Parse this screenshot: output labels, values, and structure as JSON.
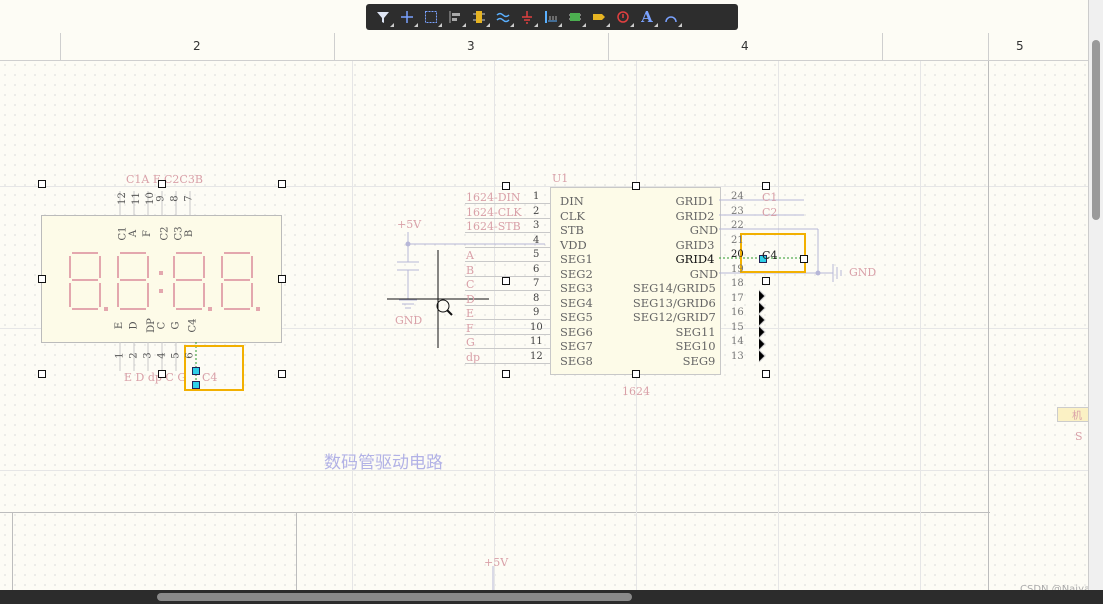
{
  "toolbar": {
    "items": [
      "filter-icon",
      "crosshair-icon",
      "select-rect-icon",
      "align-icon",
      "component-icon",
      "net-icon",
      "ground-icon",
      "bus-icon",
      "harness-icon",
      "port-icon",
      "sheet-symbol-icon",
      "text-icon",
      "arc-icon"
    ]
  },
  "ruler": {
    "cols": [
      "2",
      "3",
      "4",
      "5"
    ]
  },
  "display": {
    "top_labels": "C1A  F  C2C3B",
    "top_pins": [
      "12",
      "11",
      "10",
      "9",
      "8",
      "7"
    ],
    "face_top": [
      "C1",
      "A",
      "F",
      "C2",
      "C3",
      "B"
    ],
    "face_bottom": [
      "E",
      "D",
      "DP",
      "C",
      "G",
      "C4"
    ],
    "bottom_pins": [
      "1",
      "2",
      "3",
      "4",
      "5",
      "6"
    ],
    "bottom_labels": "E  D  dp C  G",
    "digits": "8.8:8.8.",
    "sel_label": "C4"
  },
  "power": {
    "vcc": "+5V",
    "gnd": "GND",
    "vcc2": "+5V"
  },
  "chip": {
    "ref": "U1",
    "name": "1624",
    "left_nets": [
      "1624-DIN",
      "1624-CLK",
      "1624-STB",
      "",
      "A",
      "B",
      "C",
      "D",
      "E",
      "F",
      "G",
      "dp"
    ],
    "left_nums": [
      "1",
      "2",
      "3",
      "4",
      "5",
      "6",
      "7",
      "8",
      "9",
      "10",
      "11",
      "12"
    ],
    "left_pins": [
      "DIN",
      "CLK",
      "STB",
      "VDD",
      "SEG1",
      "SEG2",
      "SEG3",
      "SEG4",
      "SEG5",
      "SEG6",
      "SEG7",
      "SEG8"
    ],
    "right_pins": [
      "GRID1",
      "GRID2",
      "GND",
      "GRID3",
      "GRID4",
      "GND",
      "SEG14/GRID5",
      "SEG13/GRID6",
      "SEG12/GRID7",
      "SEG11",
      "SEG10",
      "SEG9"
    ],
    "right_nums": [
      "24",
      "23",
      "22",
      "21",
      "20",
      "19",
      "18",
      "17",
      "16",
      "15",
      "14",
      "13"
    ],
    "right_nets": [
      "C1",
      "C2",
      "",
      "",
      "C4",
      "",
      "",
      "",
      "",
      "",
      "",
      ""
    ]
  },
  "right_gnd": "GND",
  "title_cn": "数码管驱动电路",
  "side_cn1": "机",
  "side_cn2": "S",
  "watermark": "CSDN @Naiya"
}
